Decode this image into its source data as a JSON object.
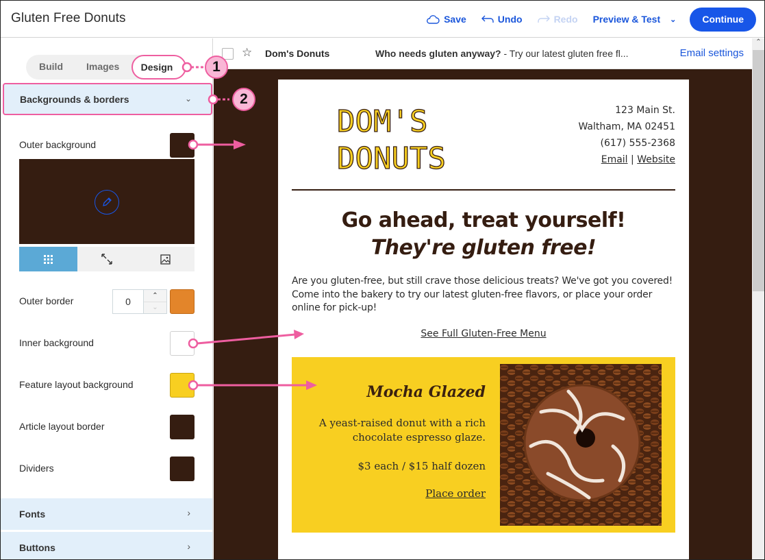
{
  "app": {
    "title": "Gluten Free Donuts",
    "actions": {
      "save": "Save",
      "undo": "Undo",
      "redo": "Redo",
      "preview": "Preview & Test",
      "continue": "Continue"
    }
  },
  "sidebar": {
    "tabs": [
      {
        "label": "Build",
        "active": false
      },
      {
        "label": "Images",
        "active": false
      },
      {
        "label": "Design",
        "active": true
      }
    ],
    "open_section": {
      "label": "Backgrounds & borders",
      "rows": {
        "outer_background": {
          "label": "Outer background",
          "color": "#351d11"
        },
        "outer_border": {
          "label": "Outer border",
          "value": "0",
          "color": "#e3852a"
        },
        "inner_background": {
          "label": "Inner background",
          "color": "#ffffff"
        },
        "feature_layout_background": {
          "label": "Feature layout background",
          "color": "#f8cf21"
        },
        "article_layout_border": {
          "label": "Article layout border",
          "color": "#351d11"
        },
        "dividers": {
          "label": "Dividers",
          "color": "#351d11"
        }
      },
      "background_modes": [
        "tile-icon",
        "stretch-icon",
        "image-icon"
      ],
      "active_mode": "tile-icon"
    },
    "collapsed_sections": [
      {
        "label": "Fonts"
      },
      {
        "label": "Buttons"
      }
    ]
  },
  "email_header": {
    "from": "Dom's Donuts",
    "subject": "Who needs gluten anyway?",
    "preheader": " - Try our latest gluten free fl...",
    "settings_link": "Email settings"
  },
  "email": {
    "logo_line1": "DOM'S",
    "logo_line2": "DONUTS",
    "address": {
      "street": "123 Main St.",
      "city": "Waltham, MA 02451",
      "phone": "(617) 555-2368",
      "email_link": "Email",
      "separator": " | ",
      "website_link": "Website"
    },
    "headline": "Go ahead, treat yourself!",
    "subheadline": "They're gluten free!",
    "body": "Are you gluten-free, but still crave those delicious treats? We've got you covered! Come into the bakery to try our latest gluten-free flavors, or place your order online for pick-up!",
    "menu_link": "See Full Gluten-Free Menu",
    "feature": {
      "title": "Mocha Glazed",
      "description": "A yeast-raised donut with a rich chocolate espresso glaze.",
      "price": "$3 each / $15 half dozen",
      "link": "Place order"
    }
  },
  "annotations": {
    "badge1": "1",
    "badge2": "2"
  }
}
